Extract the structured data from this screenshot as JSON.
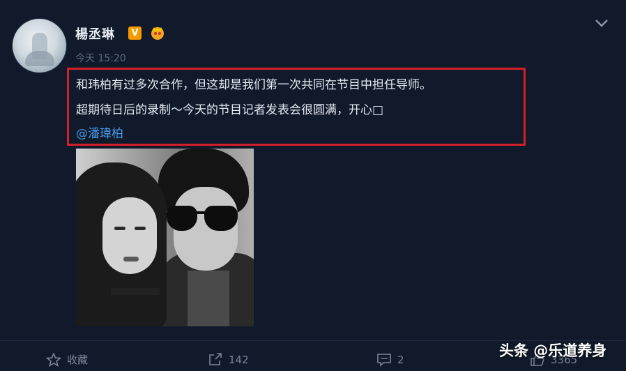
{
  "post": {
    "author": "楊丞琳",
    "verified_badge": "V",
    "timestamp": "今天 15:20",
    "text_line1": "和玮柏有过多次合作，但这却是我们第一次共同在节目中担任导师。",
    "text_line2": "超期待日后的录制～今天的节目记者发表会很圆满，开心□",
    "mention": "@潘瑋柏",
    "photo_alt": "photo",
    "highlight_color": "#d41f2c",
    "link_color": "#4a9ae8"
  },
  "actions": {
    "favorite_label": "收藏",
    "share_count": "142",
    "comment_count": "2",
    "like_count": "3365"
  },
  "watermark": "头条 @乐道养身",
  "icons": [
    "chevron-down-icon",
    "crown-icon",
    "star-icon",
    "share-icon",
    "comment-icon",
    "like-icon"
  ]
}
